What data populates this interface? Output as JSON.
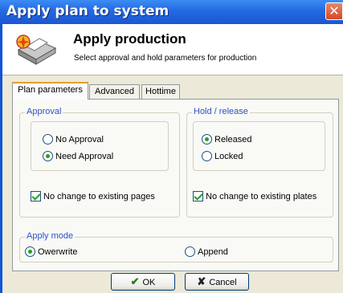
{
  "window": {
    "title": "Apply plan to system",
    "close_glyph": "✕",
    "close_icon": "close-icon"
  },
  "header": {
    "icon": "printer-icon",
    "title": "Apply production",
    "subtitle": "Select approval and hold parameters for production"
  },
  "tabs": [
    {
      "label": "Plan parameters",
      "active": true
    },
    {
      "label": "Advanced",
      "active": false
    },
    {
      "label": "Hottime",
      "active": false
    }
  ],
  "approval": {
    "label": "Approval",
    "options": [
      {
        "label": "No Approval",
        "selected": false
      },
      {
        "label": "Need Approval",
        "selected": true
      }
    ],
    "no_change_label": "No change to existing pages",
    "no_change_checked": true
  },
  "hold": {
    "label": "Hold / release",
    "options": [
      {
        "label": "Released",
        "selected": true
      },
      {
        "label": "Locked",
        "selected": false
      }
    ],
    "no_change_label": "No change to existing plates",
    "no_change_checked": true
  },
  "apply_mode": {
    "label": "Apply mode",
    "options": [
      {
        "label": "Owerwrite",
        "selected": true
      },
      {
        "label": "Append",
        "selected": false
      }
    ]
  },
  "buttons": {
    "ok_label": "OK",
    "ok_glyph": "✔",
    "ok_icon": "checkmark-icon",
    "cancel_label": "Cancel",
    "cancel_glyph": "✘",
    "cancel_icon": "cross-icon"
  },
  "colors": {
    "titlebar": "#2369e0",
    "group_label": "#2b52c8",
    "ok_glyph": "#2a7a1e",
    "cancel_glyph": "#222222"
  }
}
